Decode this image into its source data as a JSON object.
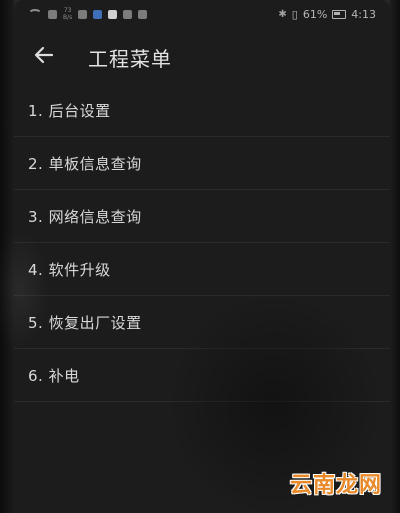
{
  "status_bar": {
    "network_speed_top": "73",
    "network_speed_bottom": "B/s",
    "battery_percent": "61%",
    "time": "4:13"
  },
  "header": {
    "title": "工程菜单"
  },
  "menu": {
    "items": [
      {
        "label": "1. 后台设置"
      },
      {
        "label": "2. 单板信息查询"
      },
      {
        "label": "3. 网络信息查询"
      },
      {
        "label": "4. 软件升级"
      },
      {
        "label": "5. 恢复出厂设置"
      },
      {
        "label": "6. 补电"
      }
    ]
  },
  "watermark": {
    "text": "云南龙网"
  },
  "colors": {
    "screen_background": "#1c1c1c",
    "text_primary": "#d8d8d8",
    "watermark": "#e98a2a"
  }
}
